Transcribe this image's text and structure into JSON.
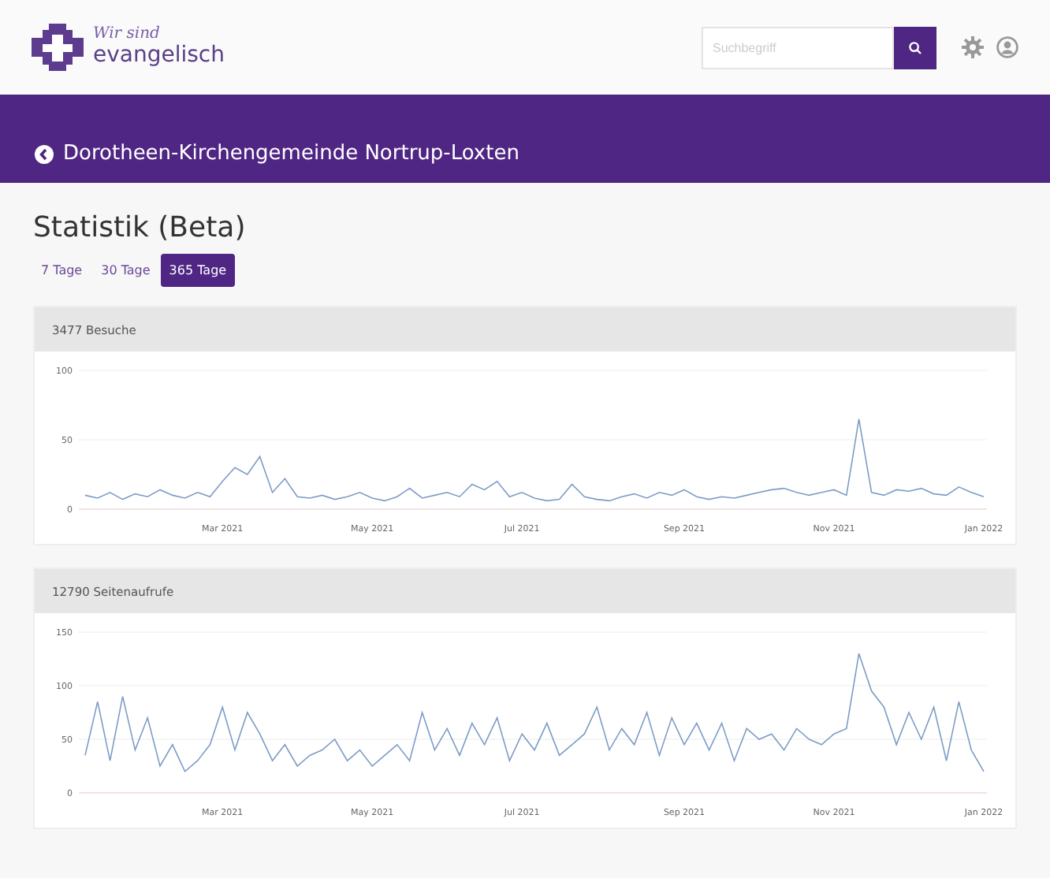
{
  "header": {
    "logo_line_1": "Wir sind",
    "logo_line_2": "evangelisch",
    "search": {
      "placeholder": "Suchbegriff"
    }
  },
  "banner": {
    "title": "Dorotheen-Kirchengemeinde Nortrup-Loxten"
  },
  "page_title": "Statistik (Beta)",
  "tabs": [
    {
      "label": "7 Tage",
      "selected": false
    },
    {
      "label": "30 Tage",
      "selected": false
    },
    {
      "label": "365 Tage",
      "selected": true
    }
  ],
  "panels": [
    {
      "title": "3477 Besuche",
      "chart_data": {
        "type": "line",
        "ylim": [
          0,
          100
        ],
        "yticks": [
          0,
          50,
          100
        ],
        "categories": [
          null,
          null,
          null,
          null,
          null,
          null,
          null,
          null,
          null,
          null,
          null,
          "Mar 2021",
          null,
          null,
          null,
          null,
          null,
          null,
          null,
          null,
          null,
          null,
          null,
          "May 2021",
          null,
          null,
          null,
          null,
          null,
          null,
          null,
          null,
          null,
          null,
          null,
          "Jul 2021",
          null,
          null,
          null,
          null,
          null,
          null,
          null,
          null,
          null,
          null,
          null,
          null,
          "Sep 2021",
          null,
          null,
          null,
          null,
          null,
          null,
          null,
          null,
          null,
          null,
          null,
          "Nov 2021",
          null,
          null,
          null,
          null,
          null,
          null,
          null,
          null,
          null,
          null,
          null,
          "Jan 2022"
        ],
        "series": [
          {
            "color": "#7d9cc6",
            "values": [
              10,
              8,
              12,
              7,
              11,
              9,
              14,
              10,
              8,
              12,
              9,
              20,
              30,
              25,
              38,
              12,
              22,
              9,
              8,
              10,
              7,
              9,
              12,
              8,
              6,
              9,
              15,
              8,
              10,
              12,
              9,
              18,
              14,
              20,
              9,
              12,
              8,
              6,
              7,
              18,
              9,
              7,
              6,
              9,
              11,
              8,
              12,
              10,
              14,
              9,
              7,
              9,
              8,
              10,
              12,
              14,
              15,
              12,
              10,
              12,
              14,
              10,
              65,
              12,
              10,
              14,
              13,
              15,
              11,
              10,
              16,
              12,
              9
            ]
          }
        ]
      }
    },
    {
      "title": "12790 Seitenaufrufe",
      "chart_data": {
        "type": "line",
        "ylim": [
          0,
          150
        ],
        "yticks": [
          0,
          50,
          100,
          150
        ],
        "categories": [
          null,
          null,
          null,
          null,
          null,
          null,
          null,
          null,
          null,
          null,
          null,
          "Mar 2021",
          null,
          null,
          null,
          null,
          null,
          null,
          null,
          null,
          null,
          null,
          null,
          "May 2021",
          null,
          null,
          null,
          null,
          null,
          null,
          null,
          null,
          null,
          null,
          null,
          "Jul 2021",
          null,
          null,
          null,
          null,
          null,
          null,
          null,
          null,
          null,
          null,
          null,
          null,
          "Sep 2021",
          null,
          null,
          null,
          null,
          null,
          null,
          null,
          null,
          null,
          null,
          null,
          "Nov 2021",
          null,
          null,
          null,
          null,
          null,
          null,
          null,
          null,
          null,
          null,
          null,
          "Jan 2022"
        ],
        "series": [
          {
            "color": "#7d9cc6",
            "values": [
              35,
              85,
              30,
              90,
              40,
              70,
              25,
              45,
              20,
              30,
              45,
              80,
              40,
              75,
              55,
              30,
              45,
              25,
              35,
              40,
              50,
              30,
              40,
              25,
              35,
              45,
              30,
              75,
              40,
              60,
              35,
              65,
              45,
              70,
              30,
              55,
              40,
              65,
              35,
              45,
              55,
              80,
              40,
              60,
              45,
              75,
              35,
              70,
              45,
              65,
              40,
              65,
              30,
              60,
              50,
              55,
              40,
              60,
              50,
              45,
              55,
              60,
              130,
              95,
              80,
              45,
              75,
              50,
              80,
              30,
              85,
              40,
              20
            ]
          }
        ]
      }
    }
  ]
}
